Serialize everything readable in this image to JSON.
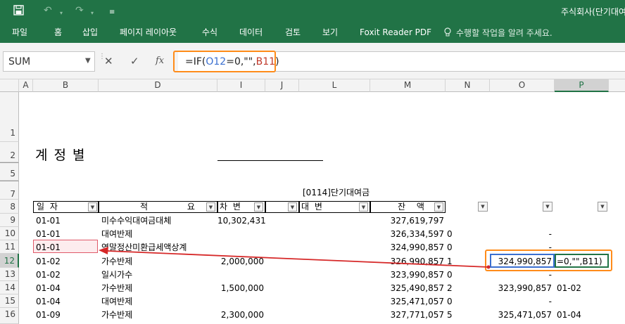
{
  "window": {
    "title": "주식회사(단기대여"
  },
  "quick_access": {
    "save_icon": "save-icon",
    "undo_icon": "undo-icon",
    "redo_icon": "redo-icon",
    "customize_icon": "customize-icon"
  },
  "ribbon": {
    "tabs": [
      "파일",
      "홈",
      "삽입",
      "페이지 레이아웃",
      "수식",
      "데이터",
      "검토",
      "보기",
      "Foxit Reader PDF"
    ],
    "tell_me": "수행할 작업을 알려 주세요."
  },
  "formula_bar": {
    "name_box": "SUM",
    "cancel_symbol": "✕",
    "enter_symbol": "✓",
    "fx_symbol": "fx",
    "formula_parts": [
      "=IF(",
      "O12",
      "=0,\"\",",
      "B11",
      ")"
    ]
  },
  "columns": [
    "A",
    "B",
    "D",
    "I",
    "J",
    "L",
    "M",
    "N",
    "O",
    "P"
  ],
  "rows": [
    "1",
    "2",
    "5",
    "7",
    "8",
    "9",
    "10",
    "11",
    "12",
    "13",
    "14",
    "15",
    "16"
  ],
  "sheet": {
    "title": "계정별",
    "account": "[0114]단기대여금",
    "headers": {
      "date": "일 자",
      "desc": "적 요",
      "debit": "차 변",
      "credit": "대 변",
      "balance": "잔 액"
    },
    "rows": [
      {
        "date": "01-01",
        "desc": "미수수익대여금대체",
        "debit": "10,302,431",
        "balance": "327,619,797",
        "n": "",
        "o": "",
        "p": ""
      },
      {
        "date": "01-01",
        "desc": "대여반제",
        "debit": "",
        "balance": "326,334,597",
        "n": "0",
        "o": "-",
        "p": ""
      },
      {
        "date": "01-01",
        "desc": "연말정산미환급세액상계",
        "debit": "",
        "balance": "324,990,857",
        "n": "0",
        "o": "-",
        "p": ""
      },
      {
        "date": "01-02",
        "desc": "가수반제",
        "debit": "2,000,000",
        "balance": "326,990,857",
        "n": "1",
        "o": "324,990,857",
        "p": "=0,\"\",B11)"
      },
      {
        "date": "01-02",
        "desc": "일시가수",
        "debit": "",
        "balance": "323,990,857",
        "n": "0",
        "o": "-",
        "p": ""
      },
      {
        "date": "01-04",
        "desc": "가수반제",
        "debit": "1,500,000",
        "balance": "325,490,857",
        "n": "2",
        "o": "323,990,857",
        "p": "01-02"
      },
      {
        "date": "01-04",
        "desc": "대여반제",
        "debit": "",
        "balance": "325,471,057",
        "n": "0",
        "o": "-",
        "p": ""
      },
      {
        "date": "01-09",
        "desc": "가수반제",
        "debit": "2,300,000",
        "balance": "327,771,057",
        "n": "5",
        "o": "325,471,057",
        "p": "01-04"
      }
    ]
  },
  "colors": {
    "excel_green": "#217346",
    "highlight_orange": "#ff8c1a",
    "ref_blue": "#3a6fd0",
    "ref_red": "#c0392b",
    "arrow_red": "#d62828"
  }
}
